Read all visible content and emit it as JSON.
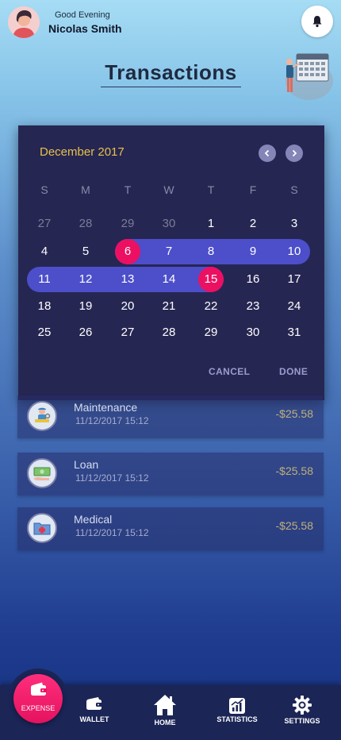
{
  "header": {
    "greeting": "Good Evening",
    "user_name": "Nicolas Smith",
    "avatar_icon": "user-avatar",
    "notification_icon": "bell-icon"
  },
  "page": {
    "title": "Transactions"
  },
  "calendar": {
    "month_label": "December 2017",
    "weekdays": [
      "S",
      "M",
      "T",
      "W",
      "T",
      "F",
      "S"
    ],
    "weeks": [
      [
        "27",
        "28",
        "29",
        "30",
        "1",
        "2",
        "3"
      ],
      [
        "4",
        "5",
        "6",
        "7",
        "8",
        "9",
        "10"
      ],
      [
        "11",
        "12",
        "13",
        "14",
        "15",
        "16",
        "17"
      ],
      [
        "18",
        "19",
        "20",
        "21",
        "22",
        "23",
        "24"
      ],
      [
        "25",
        "26",
        "27",
        "28",
        "29",
        "30",
        "31"
      ]
    ],
    "range_start": "6",
    "range_end": "15",
    "cancel_label": "CANCEL",
    "done_label": "DONE",
    "colors": {
      "month": "#e7c248",
      "range": "#4c4fc9",
      "selected": "#ec1062"
    }
  },
  "transactions": [
    {
      "name": "Maintenance",
      "date": "11/12/2017 15:12",
      "amount": "-$25.58",
      "icon": "maintenance-worker-icon"
    },
    {
      "name": "Loan",
      "date": "11/12/2017 15:12",
      "amount": "-$25.58",
      "icon": "cash-loan-icon"
    },
    {
      "name": "Medical",
      "date": "11/12/2017 15:12",
      "amount": "-$25.58",
      "icon": "medical-folder-icon"
    }
  ],
  "nav": {
    "expense_label": "EXPENSE",
    "wallet_label": "WALLET",
    "home_label": "HOME",
    "statistics_label": "STATISTICS",
    "settings_label": "SETTINGS"
  }
}
